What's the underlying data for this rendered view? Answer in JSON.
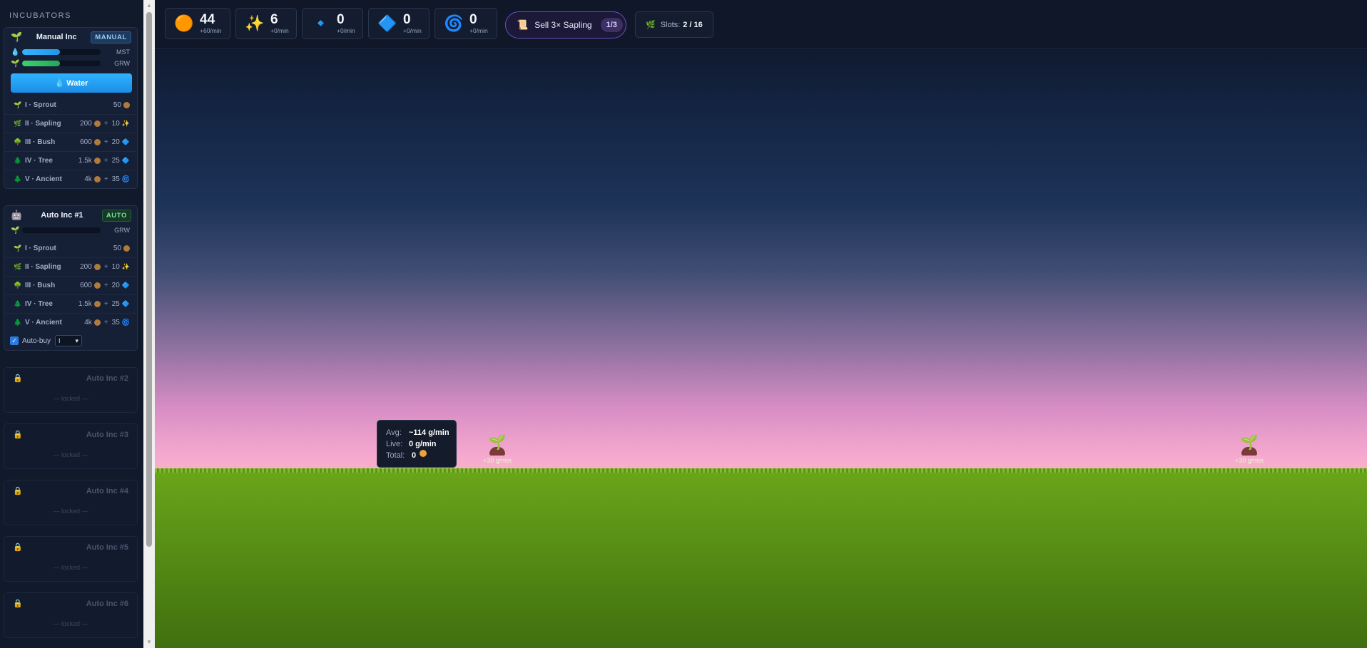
{
  "sidebar": {
    "title": "INCUBATORS",
    "manual": {
      "emoji": "🌱",
      "name": "Manual Inc",
      "badge": "MANUAL",
      "moisture": {
        "icon": "💧",
        "label": "MST",
        "fill": 0.48
      },
      "growth": {
        "icon": "🌱",
        "label": "GRW",
        "fill": 0.48
      },
      "water_button": "💧 Water",
      "tiers": [
        {
          "icon": "🌱",
          "name": "I · Sprout",
          "cost": "50",
          "bonus": "",
          "bonus_icon": ""
        },
        {
          "icon": "🌿",
          "name": "II · Sapling",
          "cost": "200",
          "bonus": "10",
          "bonus_icon": "✨"
        },
        {
          "icon": "🌳",
          "name": "III · Bush",
          "cost": "600",
          "bonus": "20",
          "bonus_icon": "🔷"
        },
        {
          "icon": "🌲",
          "name": "IV · Tree",
          "cost": "1.5k",
          "bonus": "25",
          "bonus_icon": "🔷"
        },
        {
          "icon": "🌲",
          "name": "V · Ancient",
          "cost": "4k",
          "bonus": "35",
          "bonus_icon": "🌀"
        }
      ]
    },
    "auto1": {
      "emoji": "🤖",
      "name": "Auto Inc #1",
      "badge": "AUTO",
      "growth": {
        "icon": "🌱",
        "label": "GRW",
        "fill": 0.0
      },
      "tiers": [
        {
          "icon": "🌱",
          "name": "I · Sprout",
          "cost": "50",
          "bonus": "",
          "bonus_icon": ""
        },
        {
          "icon": "🌿",
          "name": "II · Sapling",
          "cost": "200",
          "bonus": "10",
          "bonus_icon": "✨"
        },
        {
          "icon": "🌳",
          "name": "III · Bush",
          "cost": "600",
          "bonus": "20",
          "bonus_icon": "🔷"
        },
        {
          "icon": "🌲",
          "name": "IV · Tree",
          "cost": "1.5k",
          "bonus": "25",
          "bonus_icon": "🔷"
        },
        {
          "icon": "🌲",
          "name": "V · Ancient",
          "cost": "4k",
          "bonus": "35",
          "bonus_icon": "🌀"
        }
      ],
      "autobuy_label": "Auto-buy",
      "autobuy_value": "I"
    },
    "locked": [
      {
        "name": "Auto Inc #2",
        "text": "— locked —"
      },
      {
        "name": "Auto Inc #3",
        "text": "— locked —"
      },
      {
        "name": "Auto Inc #4",
        "text": "— locked —"
      },
      {
        "name": "Auto Inc #5",
        "text": "— locked —"
      },
      {
        "name": "Auto Inc #6",
        "text": "— locked —"
      }
    ]
  },
  "resources": [
    {
      "icon": "🟠",
      "value": "44",
      "rate": "+60/min"
    },
    {
      "icon": "✨",
      "value": "6",
      "rate": "+0/min"
    },
    {
      "icon": "🔹",
      "value": "0",
      "rate": "+0/min"
    },
    {
      "icon": "🔷",
      "value": "0",
      "rate": "+0/min"
    },
    {
      "icon": "🌀",
      "value": "0",
      "rate": "+0/min"
    }
  ],
  "quest": {
    "icon": "📜",
    "label": "Sell 3× Sapling",
    "progress": "1/3"
  },
  "slots": {
    "icon": "🌿",
    "label": "Slots:",
    "value": "2 / 16"
  },
  "plants": [
    {
      "rate": "+30 g/min"
    },
    {
      "rate": "+30 g/min"
    }
  ],
  "tooltip": {
    "avg_label": "Avg:",
    "avg_value": "~114 g/min",
    "live_label": "Live:",
    "live_value": "0 g/min",
    "total_label": "Total:",
    "total_value": "0"
  },
  "colors": {
    "accent": "#2196e8",
    "quest_border": "#6b4fbf",
    "ground": "#5c9616"
  }
}
